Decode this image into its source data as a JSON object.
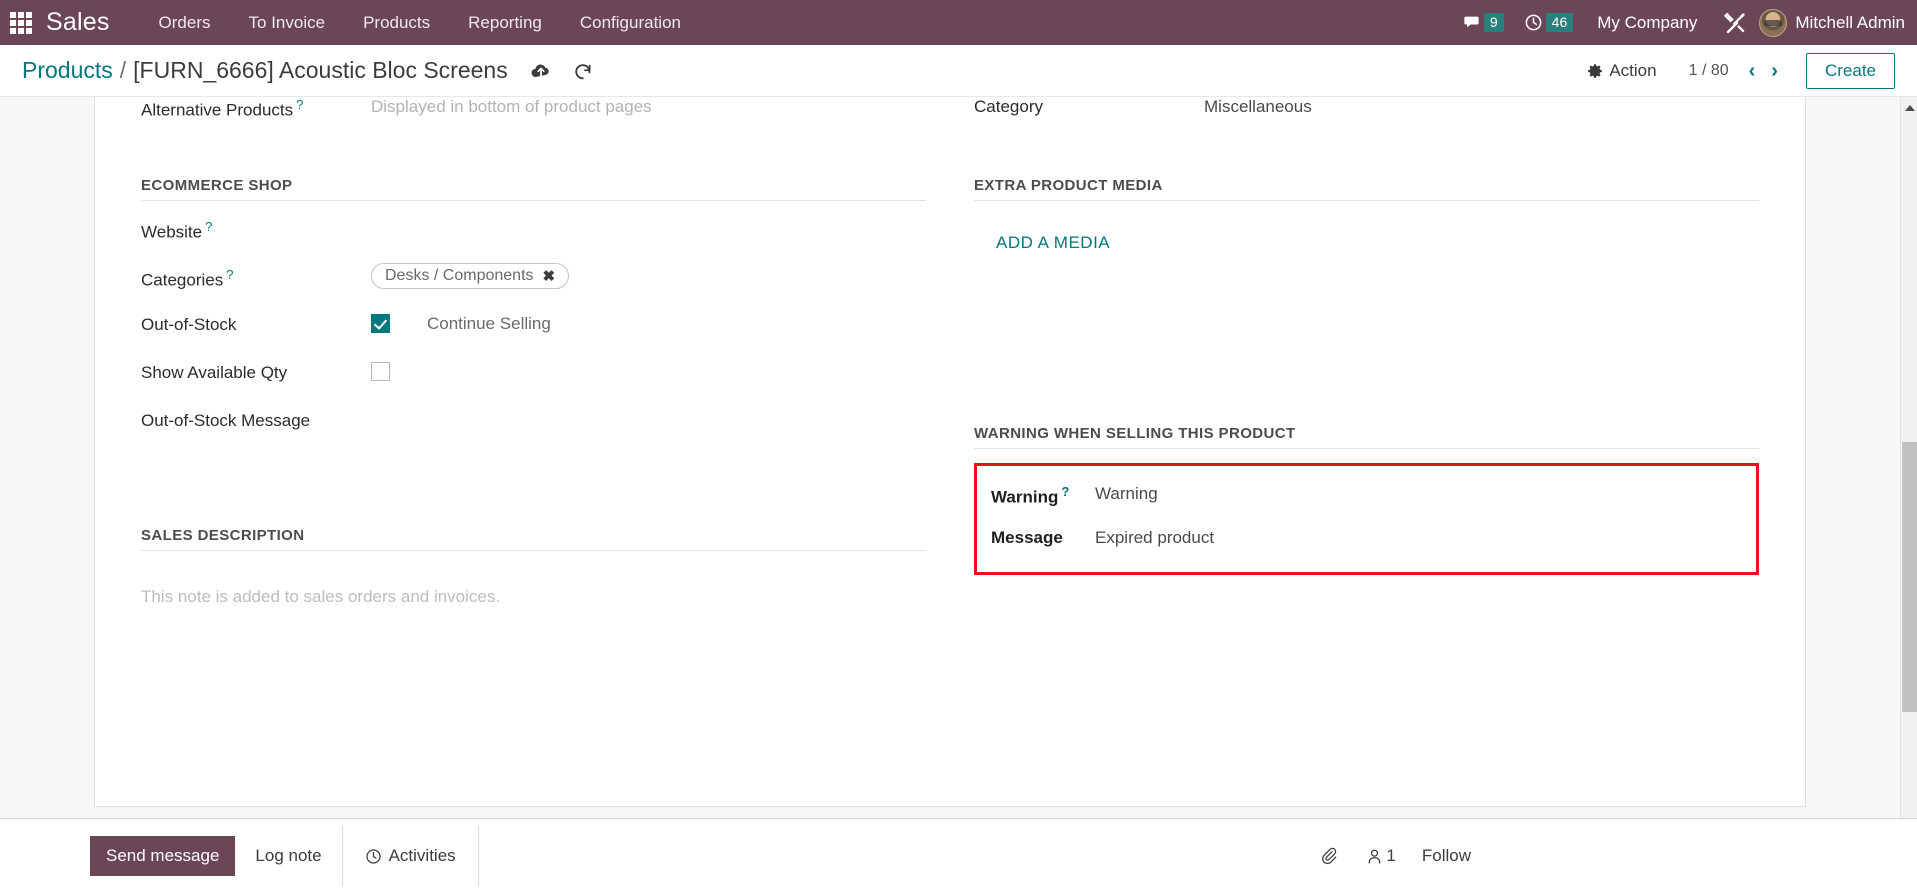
{
  "navbar": {
    "apps_icon": "apps-grid-icon",
    "brand": "Sales",
    "menu": [
      {
        "label": "Orders"
      },
      {
        "label": "To Invoice"
      },
      {
        "label": "Products"
      },
      {
        "label": "Reporting"
      },
      {
        "label": "Configuration"
      }
    ],
    "messages_icon": "chat-bubble-icon",
    "messages_count": "9",
    "activities_icon": "clock-icon",
    "activities_count": "46",
    "company": "My Company",
    "tools_icon": "wrench-screwdriver-icon",
    "avatar_icon": "user-avatar",
    "user": "Mitchell Admin",
    "bg_color": "#6b4657",
    "badge_color": "#2a7f7f"
  },
  "control_panel": {
    "breadcrumb_parent": "Products",
    "breadcrumb_separator": "/",
    "breadcrumb_current": "[FURN_6666] Acoustic Bloc Screens",
    "save_icon": "cloud-upload-icon",
    "discard_icon": "undo-arrow-icon",
    "action_icon": "gear-icon",
    "action_label": "Action",
    "pager": "1 / 80",
    "prev_icon": "chevron-left-icon",
    "next_icon": "chevron-right-icon",
    "create_label": "Create",
    "accent_color": "#00787d"
  },
  "form": {
    "top_clipped": {
      "alternative_products_label": "Alternative Products",
      "alternative_products_tip": "?",
      "alternative_products_placeholder": "Displayed in bottom of product pages",
      "category_label": "Category",
      "category_value": "Miscellaneous"
    },
    "ecommerce_shop": {
      "title": "ECOMMERCE SHOP",
      "website_label": "Website",
      "website_tip": "?",
      "website_value": "",
      "categories_label": "Categories",
      "categories_tip": "?",
      "categories_chip": "Desks / Components",
      "categories_chip_remove": "✖",
      "out_of_stock_label": "Out-of-Stock",
      "out_of_stock_checked": true,
      "continue_selling_label": "Continue Selling",
      "show_available_qty_label": "Show Available Qty",
      "show_available_qty_checked": false,
      "out_of_stock_message_label": "Out-of-Stock Message",
      "out_of_stock_message_value": ""
    },
    "extra_product_media": {
      "title": "EXTRA PRODUCT MEDIA",
      "add_media_label": "ADD A MEDIA"
    },
    "sales_description": {
      "title": "SALES DESCRIPTION",
      "placeholder": "This note is added to sales orders and invoices."
    },
    "warning_section": {
      "title": "WARNING WHEN SELLING THIS PRODUCT",
      "highlight_color": "#e8131a",
      "warning_label": "Warning",
      "warning_tip": "?",
      "warning_value": "Warning",
      "message_label": "Message",
      "message_value": "Expired product"
    }
  },
  "chatter": {
    "send_message_label": "Send message",
    "log_note_label": "Log note",
    "activities_icon": "clock-icon",
    "activities_label": "Activities",
    "attachment_icon": "paperclip-icon",
    "followers_icon": "person-icon",
    "followers_count": "1",
    "follow_label": "Follow"
  },
  "scrollbar": {
    "up_arrow_icon": "caret-up-icon",
    "down_arrow_icon": "caret-down-icon",
    "thumb": "scroll-thumb"
  }
}
